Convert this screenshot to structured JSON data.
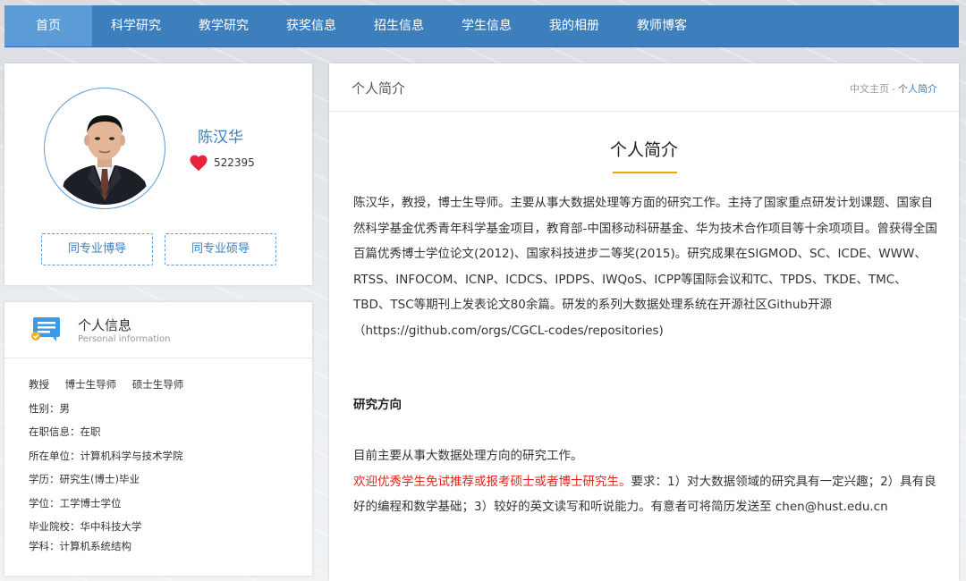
{
  "nav": {
    "items": [
      "首页",
      "科学研究",
      "教学研究",
      "获奖信息",
      "招生信息",
      "学生信息",
      "我的相册",
      "教师博客"
    ],
    "active_index": 0
  },
  "profile": {
    "name": "陈汉华",
    "likes": "522395",
    "buttons": [
      "同专业博导",
      "同专业硕导"
    ]
  },
  "info": {
    "title": "个人信息",
    "subtitle": "Personal information",
    "titles": [
      "教授",
      "博士生导师",
      "硕士生导师"
    ],
    "rows": [
      "性别：男",
      "在职信息：在职",
      "所在单位：计算机科学与技术学院",
      "学历：研究生(博士)毕业",
      "学位：工学博士学位",
      "毕业院校：华中科技大学",
      "学科：计算机系统结构"
    ]
  },
  "content": {
    "header_title": "个人简介",
    "breadcrumb": [
      "中文主页",
      "个人简介"
    ],
    "breadcrumb_sep": "-",
    "section_title": "个人简介",
    "intro": "陈汉华，教授，博士生导师。主要从事大数据处理等方面的研究工作。主持了国家重点研发计划课题、国家自然科学基金优秀青年科学基金项目，教育部-中国移动科研基金、华为技术合作项目等十余项项目。曾获得全国百篇优秀博士学位论文(2012)、国家科技进步二等奖(2015)。研究成果在SIGMOD、SC、ICDE、WWW、RTSS、INFOCOM、ICNP、ICDCS、IPDPS、IWQoS、ICPP等国际会议和TC、TPDS、TKDE、TMC、TBD、TSC等期刊上发表论文80余篇。研发的系列大数据处理系统在开源社区Github开源（https://github.com/orgs/CGCL-codes/repositories)",
    "direction_title": "研究方向",
    "direction_text": "目前主要从事大数据处理方向的研究工作。",
    "recruit_red": "欢迎优秀学生免试推荐或报考硕士或者博士研究生。",
    "recruit_text": "要求：1）对大数据领域的研究具有一定兴趣；2）具有良好的编程和数学基础；3）较好的英文读写和听说能力。有意者可将简历发送至 chen@hust.edu.cn"
  },
  "colors": {
    "nav_bg": "#3d7fbd",
    "nav_active": "#5b9bd6",
    "accent": "#3d7fbd",
    "underline": "#f0a500",
    "highlight_red": "#e2231a",
    "heart": "#e8243c"
  },
  "icons": {
    "likes": "heart-icon",
    "info": "info-card-icon",
    "avatar": "portrait-photo"
  }
}
